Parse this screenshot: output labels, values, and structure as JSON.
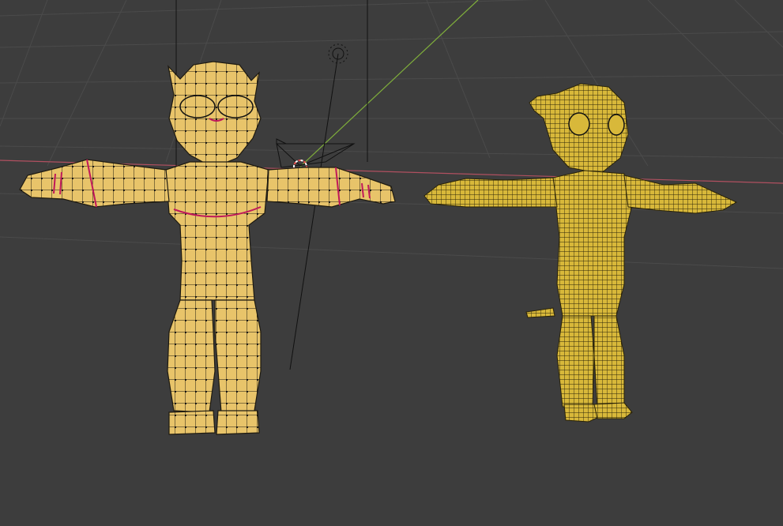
{
  "viewport": {
    "background": "#3d3d3d",
    "grid_color": "#4a4a4a",
    "x_axis_color": "#b05060",
    "y_axis_color": "#7fae3b",
    "scene_objects": [
      "camera",
      "light",
      "3d-cursor",
      "low-poly-character-mesh",
      "subdivided-character-mesh"
    ]
  },
  "meshes": {
    "left": {
      "name": "low-poly-character-mesh",
      "fill": "#e8c46a",
      "wire": "#1e1a10",
      "seam_color": "#c0185a",
      "mode": "edit"
    },
    "right": {
      "name": "subdivided-character-mesh",
      "fill": "#d8b83a",
      "wire": "#2a2308",
      "mode": "object"
    }
  }
}
